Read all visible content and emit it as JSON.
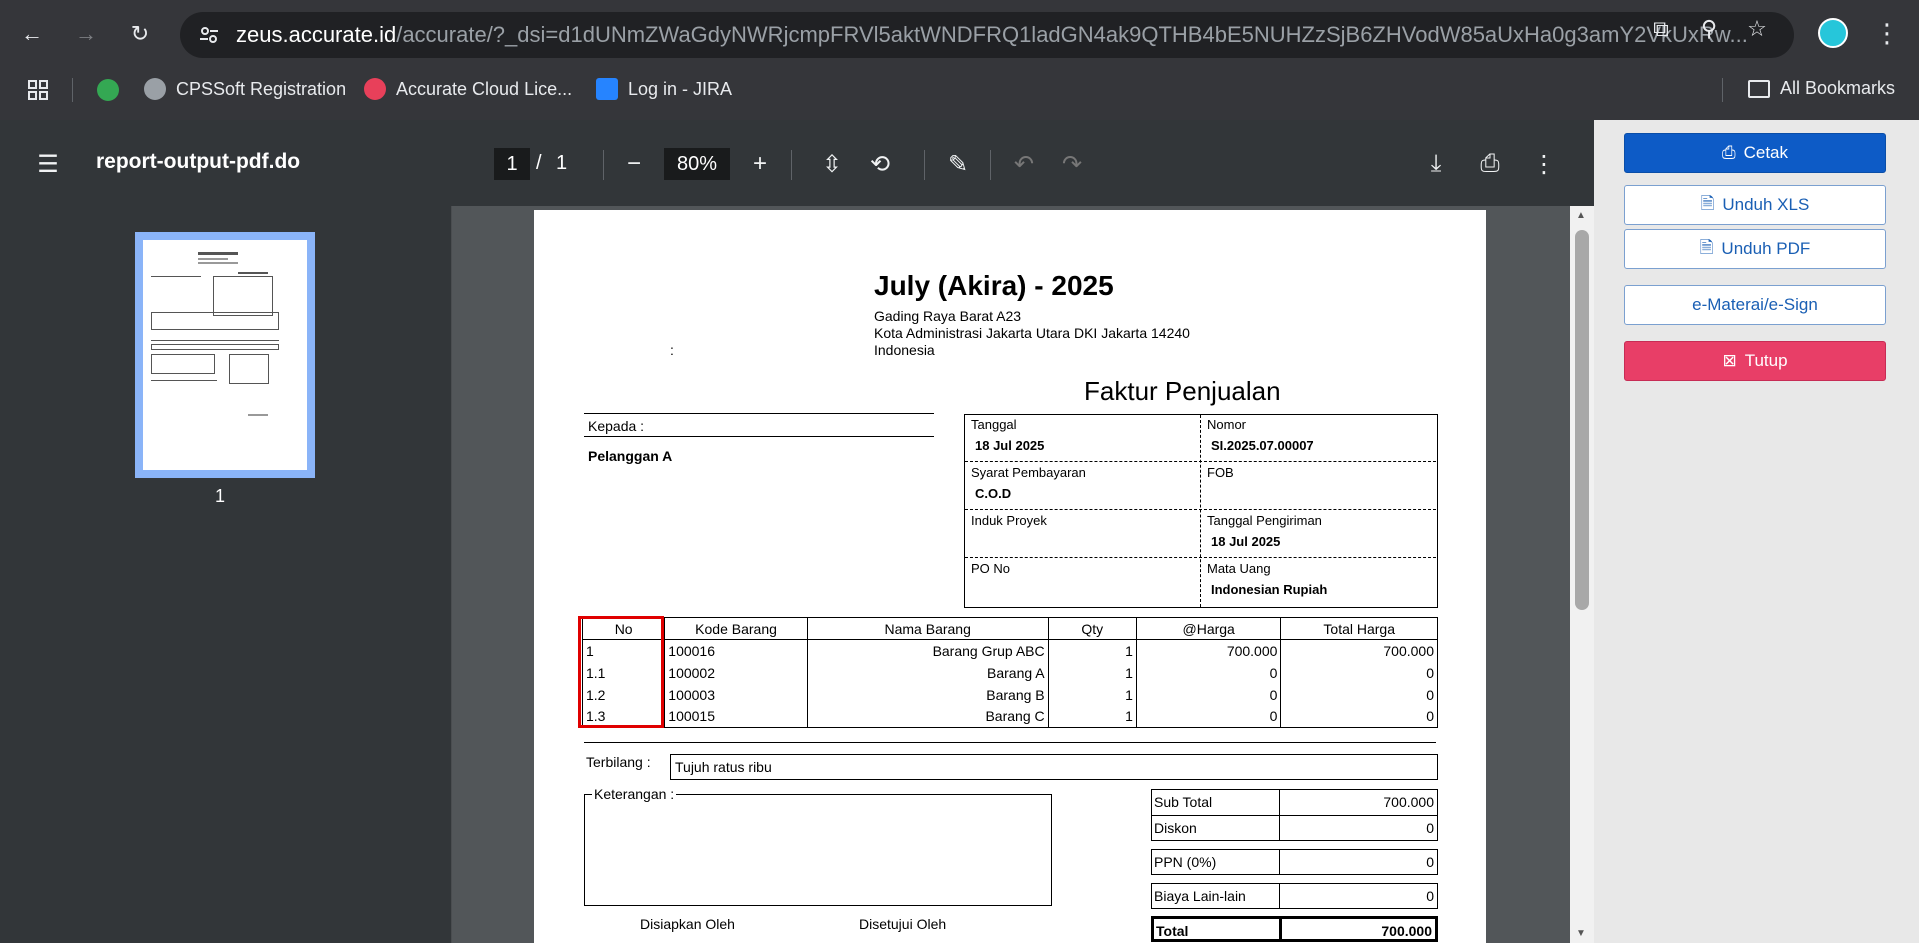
{
  "browser": {
    "url_host": "zeus.accurate.id",
    "url_path": "/accurate/?_dsi=d1dUNmZWaGdyNWRjcmpFRVl5aktWNDFRQ1ladGN4ak9QTHB4bE5NUHZzSjB6ZHVodW85aUxHa0g3amY2VkUxRw...",
    "bookmarks": [
      "CPSSoft Registration",
      "Accurate Cloud Lice...",
      "Log in - JIRA"
    ],
    "all_bookmarks": "All Bookmarks"
  },
  "pdf_toolbar": {
    "title": "report-output-pdf.do",
    "page_current": "1",
    "page_sep": "/",
    "page_total": "1",
    "zoom": "80%"
  },
  "sidebar": {
    "thumbnail_page": "1"
  },
  "doc": {
    "company": "July (Akira) - 2025",
    "address": [
      "Gading Raya Barat A23",
      "Kota Administrasi Jakarta Utara DKI Jakarta 14240",
      "Indonesia"
    ],
    "colon": ":",
    "title": "Faktur Penjualan",
    "kepada_label": "Kepada :",
    "customer": "Pelanggan A",
    "info": {
      "tanggal_label": "Tanggal",
      "tanggal": "18 Jul 2025",
      "nomor_label": "Nomor",
      "nomor": "SI.2025.07.00007",
      "syarat_label": "Syarat Pembayaran",
      "syarat": "C.O.D",
      "fob_label": "FOB",
      "induk_label": "Induk Proyek",
      "tgl_kirim_label": "Tanggal Pengiriman",
      "tgl_kirim": "18 Jul 2025",
      "po_label": "PO No",
      "mata_uang_label": "Mata Uang",
      "mata_uang": "Indonesian Rupiah"
    },
    "columns": [
      "No",
      "Kode Barang",
      "Nama Barang",
      "Qty",
      "@Harga",
      "Total Harga"
    ],
    "rows": [
      {
        "no": "1",
        "kode": "100016",
        "nama": "Barang Grup ABC",
        "qty": "1",
        "harga": "700.000",
        "total": "700.000"
      },
      {
        "no": "1.1",
        "kode": "100002",
        "nama": "Barang A",
        "qty": "1",
        "harga": "0",
        "total": "0"
      },
      {
        "no": "1.2",
        "kode": "100003",
        "nama": "Barang B",
        "qty": "1",
        "harga": "0",
        "total": "0"
      },
      {
        "no": "1.3",
        "kode": "100015",
        "nama": "Barang C",
        "qty": "1",
        "harga": "0",
        "total": "0"
      }
    ],
    "terbilang_label": "Terbilang :",
    "terbilang": "Tujuh ratus ribu",
    "keterangan_label": "Keterangan :",
    "disiapkan": "Disiapkan Oleh",
    "disetujui": "Disetujui Oleh",
    "totals": {
      "subtotal_label": "Sub Total",
      "subtotal": "700.000",
      "diskon_label": "Diskon",
      "diskon": "0",
      "ppn_label": "PPN (0%)",
      "ppn": "0",
      "biaya_label": "Biaya Lain-lain",
      "biaya": "0",
      "total_label": "Total",
      "total": "700.000"
    }
  },
  "actions": {
    "cetak": "Cetak",
    "unduh_xls": "Unduh XLS",
    "unduh_pdf": "Unduh PDF",
    "materai": "e-Materai/e-Sign",
    "tutup": "Tutup"
  },
  "colors": {
    "primary": "#0d5bc6",
    "danger": "#e83e67",
    "highlight": "#e00000"
  }
}
